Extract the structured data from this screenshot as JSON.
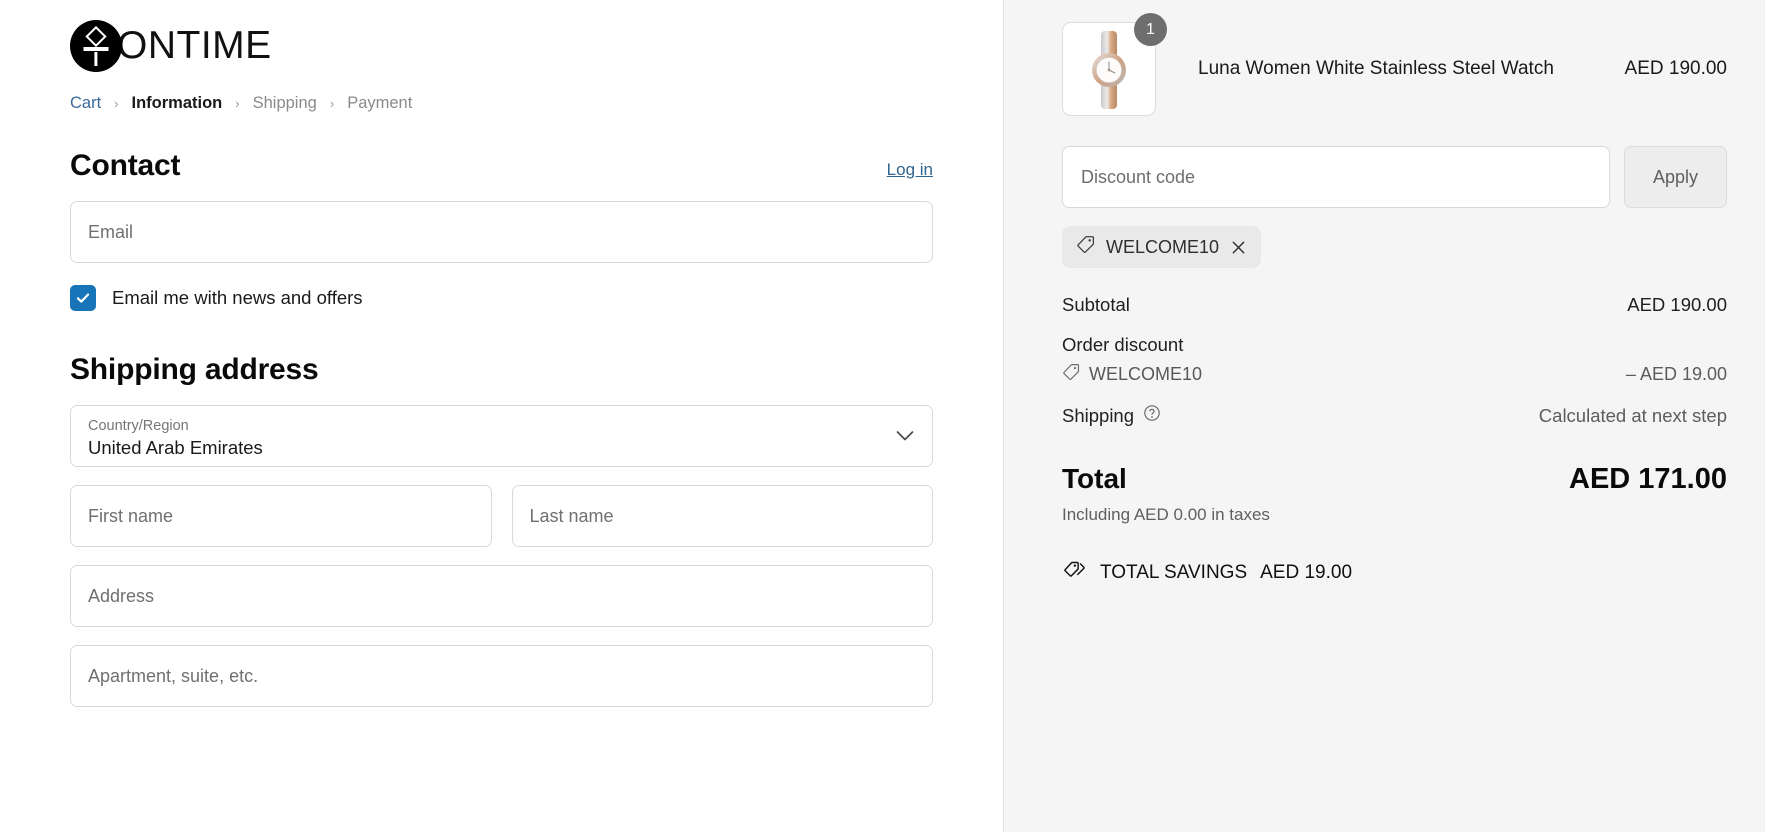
{
  "brand": {
    "name": "ONTIME",
    "logo_icon": "ontime-watch-logo"
  },
  "breadcrumb": {
    "items": [
      {
        "label": "Cart",
        "state": "link"
      },
      {
        "label": "Information",
        "state": "current"
      },
      {
        "label": "Shipping",
        "state": "muted"
      },
      {
        "label": "Payment",
        "state": "muted"
      }
    ],
    "separator": "›"
  },
  "contact": {
    "title": "Contact",
    "login_label": "Log in",
    "email": {
      "placeholder": "Email",
      "value": ""
    },
    "newsletter": {
      "label": "Email me with news and offers",
      "checked": true
    }
  },
  "shipping_address": {
    "title": "Shipping address",
    "country": {
      "label": "Country/Region",
      "value": "United Arab Emirates"
    },
    "first_name": {
      "placeholder": "First name",
      "value": ""
    },
    "last_name": {
      "placeholder": "Last name",
      "value": ""
    },
    "address": {
      "placeholder": "Address",
      "value": ""
    },
    "apartment": {
      "placeholder": "Apartment, suite, etc.",
      "value": ""
    }
  },
  "order_summary": {
    "item": {
      "name": "Luna Women White Stainless Steel Watch",
      "price": "AED 190.00",
      "quantity": "1",
      "image_alt": "luna-women-white-stainless-steel-watch"
    },
    "discount": {
      "placeholder": "Discount code",
      "value": "",
      "apply_label": "Apply",
      "applied_code": "WELCOME10"
    },
    "rows": [
      {
        "label": "Subtotal",
        "value": "AED 190.00"
      },
      {
        "label": "Order discount",
        "value": ""
      },
      {
        "label": "WELCOME10",
        "value": "– AED 19.00"
      },
      {
        "label": "Shipping",
        "value": "Calculated at next step"
      }
    ],
    "total": {
      "label": "Total",
      "value": "AED 171.00",
      "taxes_note": "Including AED 0.00 in taxes"
    },
    "savings": {
      "label": "TOTAL SAVINGS",
      "value": "AED 19.00"
    }
  },
  "colors": {
    "link": "#3a6a98",
    "checkbox": "#1874b8",
    "panel_bg": "#f5f5f5",
    "badge": "#6e6e6e"
  }
}
